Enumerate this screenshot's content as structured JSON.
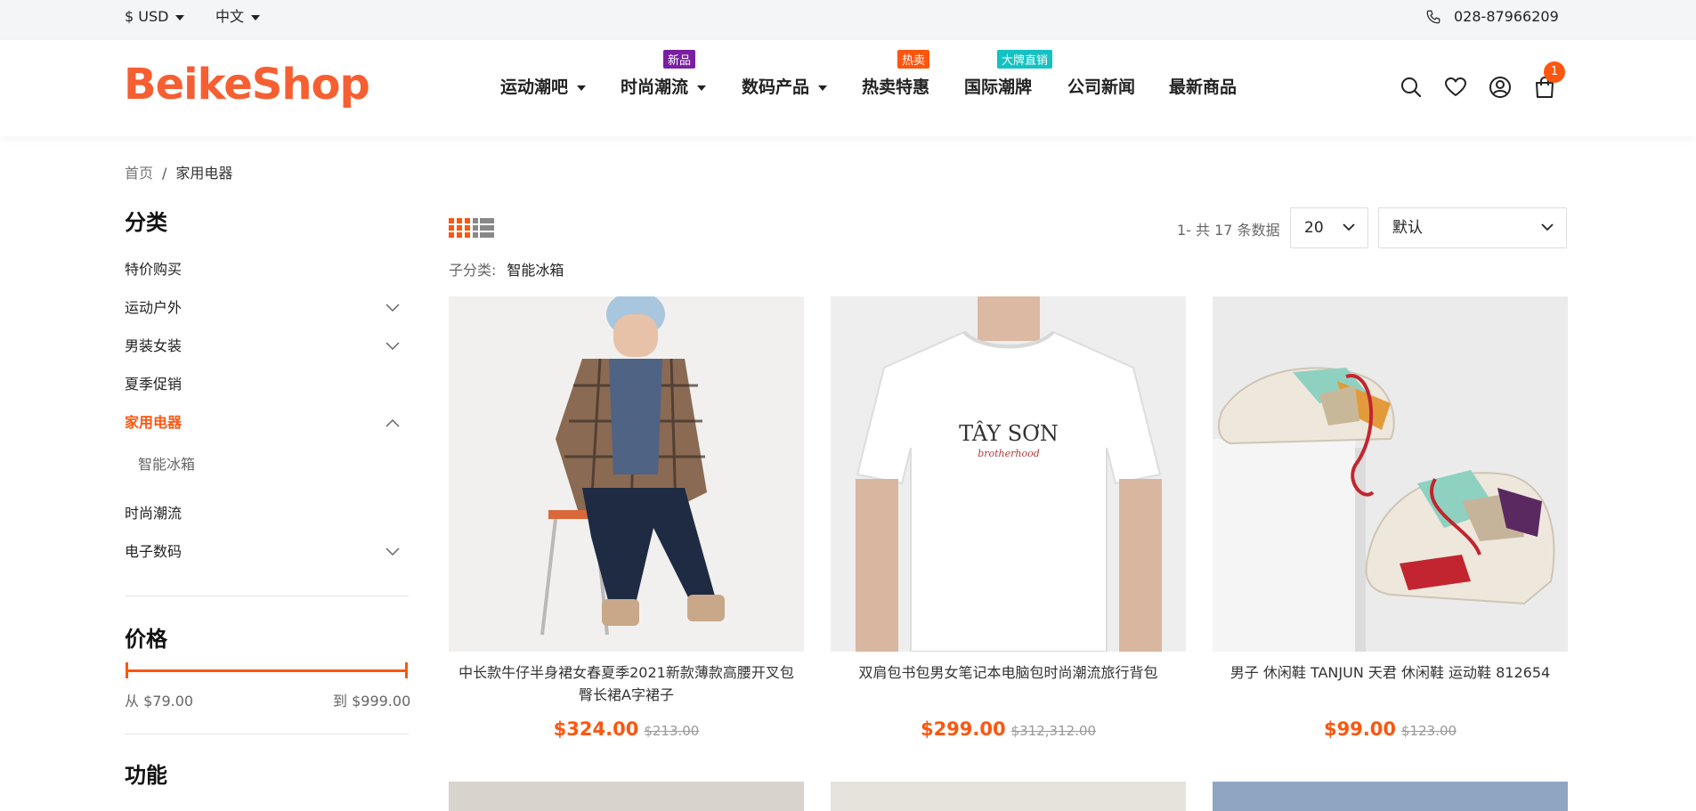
{
  "topbar": {
    "currency": "$ USD",
    "language": "中文",
    "phone": "028-87966209"
  },
  "header": {
    "logo": "BeikeShop",
    "nav": [
      {
        "label": "运动潮吧",
        "dropdown": true
      },
      {
        "label": "时尚潮流",
        "dropdown": true,
        "badge": "新品",
        "badge_color": "#7a1fa2"
      },
      {
        "label": "数码产品",
        "dropdown": true
      },
      {
        "label": "热卖特惠",
        "badge": "热卖",
        "badge_color": "#fd560f"
      },
      {
        "label": "国际潮牌",
        "badge": "大牌直销",
        "badge_color": "#13c2c2"
      },
      {
        "label": "公司新闻"
      },
      {
        "label": "最新商品"
      }
    ],
    "icons": [
      "search-icon",
      "heart-icon",
      "user-icon",
      "cart-icon"
    ],
    "cart_count": "1"
  },
  "breadcrumb": {
    "home": "首页",
    "separator": "/",
    "current": "家用电器"
  },
  "sidebar": {
    "category_title": "分类",
    "categories": [
      {
        "label": "特价购买"
      },
      {
        "label": "运动户外",
        "expandable": true
      },
      {
        "label": "男装女装",
        "expandable": true
      },
      {
        "label": "夏季促销"
      },
      {
        "label": "家用电器",
        "active": true,
        "expanded": true
      },
      {
        "label": "智能冰箱",
        "sub": true
      },
      {
        "label": "时尚潮流"
      },
      {
        "label": "电子数码",
        "expandable": true
      }
    ],
    "price_title": "价格",
    "price_from": "从 $79.00",
    "price_to": "到 $999.00",
    "feature_title": "功能"
  },
  "toolbar": {
    "count_text": "1- 共 17 条数据",
    "per_page": "20",
    "sort": "默认",
    "subcategory_label": "子分类:",
    "subcategory_value": "智能冰箱"
  },
  "products": [
    {
      "name": "中长款牛仔半身裙女春夏季2021新款薄款高腰开叉包臀长裙A字裙子",
      "price": "$324.00",
      "old_price": "$213.00"
    },
    {
      "name": "双肩包书包男女笔记本电脑包时尚潮流旅行背包",
      "price": "$299.00",
      "old_price": "$312,312.00"
    },
    {
      "name": "男子 休闲鞋 TANJUN 天君 休闲鞋 运动鞋 812654",
      "price": "$99.00",
      "old_price": "$123.00"
    }
  ],
  "colors": {
    "accent": "#fd560f",
    "topbar_bg": "#f4f5f7"
  }
}
